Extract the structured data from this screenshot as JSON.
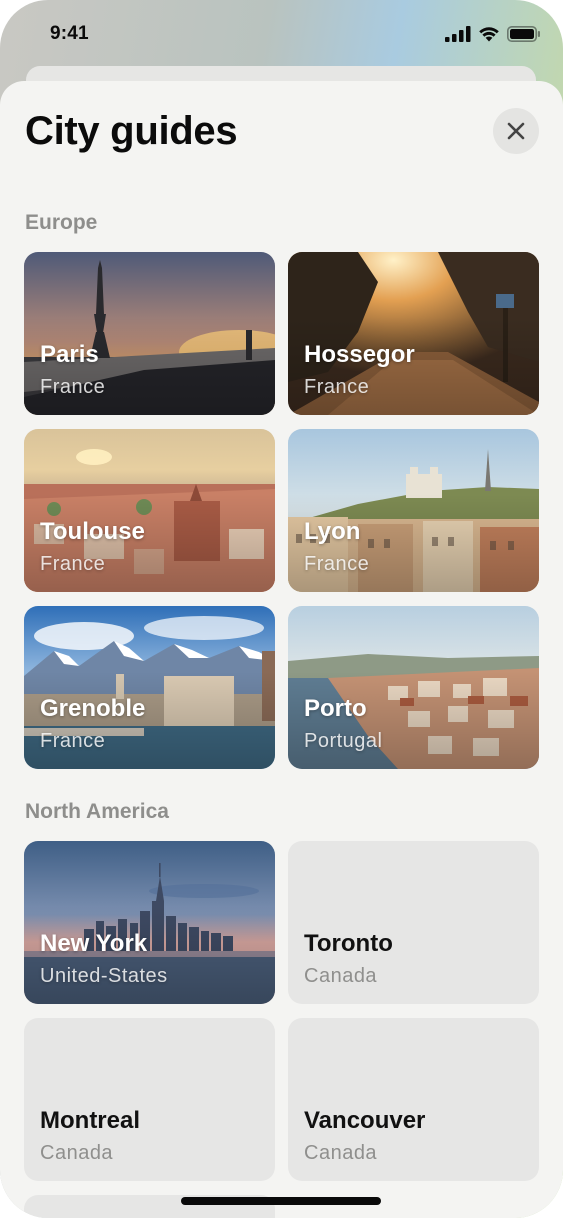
{
  "status_bar": {
    "time": "9:41",
    "icons": [
      "cellular-signal-icon",
      "wifi-icon",
      "battery-icon"
    ]
  },
  "sheet": {
    "title": "City guides",
    "close_icon": "close-icon"
  },
  "sections": [
    {
      "title": "Europe",
      "cities": [
        {
          "name": "Paris",
          "country": "France"
        },
        {
          "name": "Hossegor",
          "country": "France"
        },
        {
          "name": "Toulouse",
          "country": "France"
        },
        {
          "name": "Lyon",
          "country": "France"
        },
        {
          "name": "Grenoble",
          "country": "France"
        },
        {
          "name": "Porto",
          "country": "Portugal"
        }
      ]
    },
    {
      "title": "North America",
      "cities": [
        {
          "name": "New York",
          "country": "United-States"
        },
        {
          "name": "Toronto",
          "country": "Canada"
        },
        {
          "name": "Montreal",
          "country": "Canada"
        },
        {
          "name": "Vancouver",
          "country": "Canada"
        }
      ]
    }
  ]
}
